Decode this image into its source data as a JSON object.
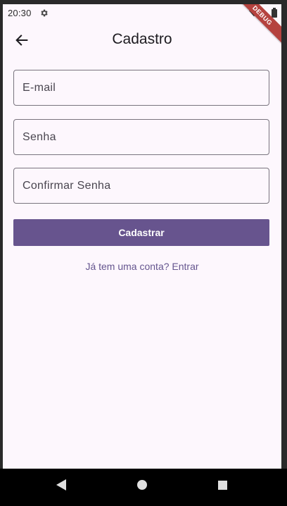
{
  "status_bar": {
    "time": "20:30",
    "icons": [
      "gear-icon",
      "wifi-icon",
      "battery-icon"
    ],
    "debug_banner": "DEBUG"
  },
  "app_bar": {
    "title": "Cadastro",
    "back_icon": "arrow-left-icon"
  },
  "form": {
    "email_placeholder": "E-mail",
    "email_value": "",
    "password_placeholder": "Senha",
    "password_value": "",
    "confirm_placeholder": "Confirmar Senha",
    "confirm_value": "",
    "submit_label": "Cadastrar",
    "login_link": "Já tem uma conta? Entrar"
  },
  "nav_bar": {
    "icons": [
      "nav-back-icon",
      "nav-home-icon",
      "nav-recents-icon"
    ]
  },
  "colors": {
    "background": "#fdf7fd",
    "primary": "#67548e",
    "link": "#65558f",
    "outline": "#79747e",
    "debug_ribbon": "#b5423f"
  }
}
